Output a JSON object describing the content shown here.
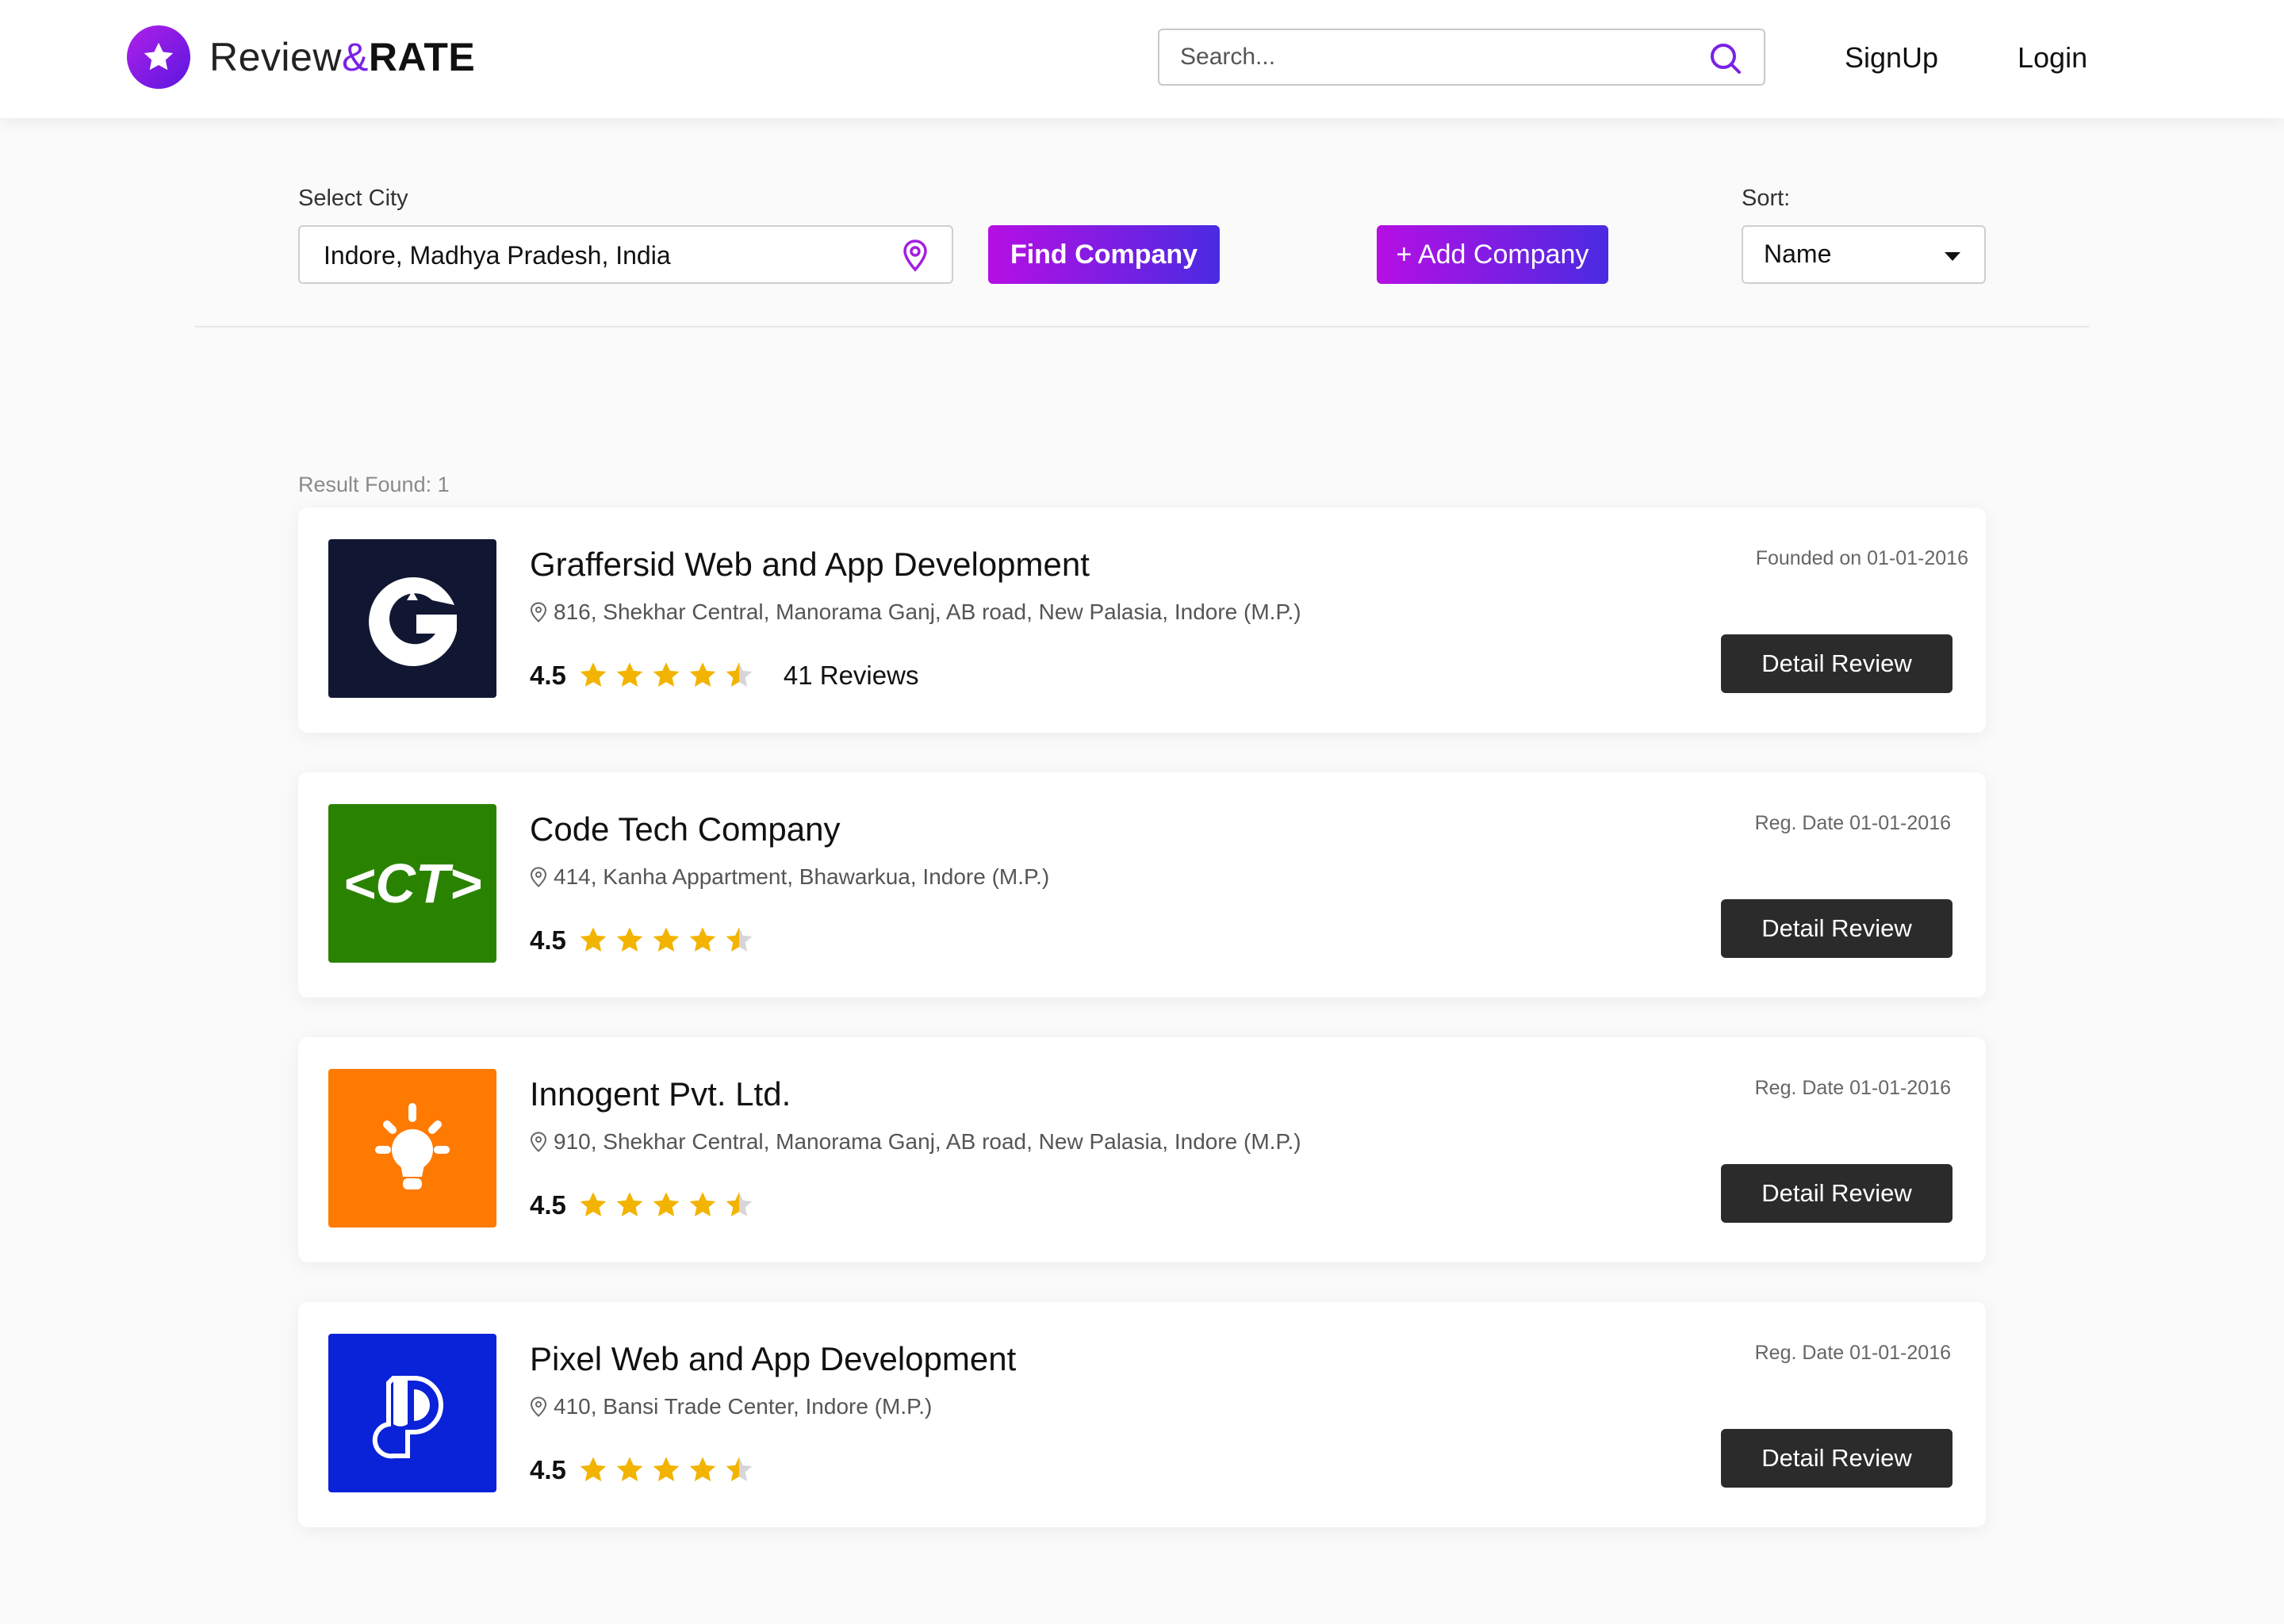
{
  "brand": {
    "name_main": "Review",
    "name_amp": "&",
    "name_rate": "RATE",
    "logo_icon": "star-icon",
    "accent": "#7a22e6"
  },
  "header": {
    "search_placeholder": "Search...",
    "signup_label": "SignUp",
    "login_label": "Login"
  },
  "filters": {
    "city_label": "Select City",
    "city_value": "Indore, Madhya Pradesh, India",
    "find_label": "Find Company",
    "add_label": "+ Add Company",
    "sort_label": "Sort:",
    "sort_value": "Name"
  },
  "results": {
    "count_text": "Result Found: 1",
    "companies": [
      {
        "name": "Graffersid Web and App Development",
        "address": "816, Shekhar Central, Manorama Ganj, AB road, New Palasia, Indore (M.P.)",
        "rating": "4.5",
        "rating_value": 4.5,
        "reviews": "41 Reviews",
        "date_text": "Founded on 01-01-2016",
        "button": "Detail Review",
        "logo_color": "#111733"
      },
      {
        "name": "Code Tech Company",
        "address": "414, Kanha Appartment, Bhawarkua, Indore (M.P.)",
        "rating": "4.5",
        "rating_value": 4.5,
        "date_text": "Reg. Date  01-01-2016",
        "button": "Detail Review",
        "logo_text": "<CT>",
        "logo_color": "#2a8300"
      },
      {
        "name": "Innogent Pvt. Ltd.",
        "address": "910, Shekhar Central, Manorama Ganj, AB road, New Palasia, Indore (M.P.)",
        "rating": "4.5",
        "rating_value": 4.5,
        "date_text": "Reg. Date  01-01-2016",
        "button": "Detail Review",
        "logo_color": "#ff7a00"
      },
      {
        "name": "Pixel Web and App Development",
        "address": "410, Bansi Trade Center, Indore (M.P.)",
        "rating": "4.5",
        "rating_value": 4.5,
        "date_text": "Reg. Date  01-01-2016",
        "button": "Detail Review",
        "logo_color": "#0a22d8"
      }
    ]
  }
}
